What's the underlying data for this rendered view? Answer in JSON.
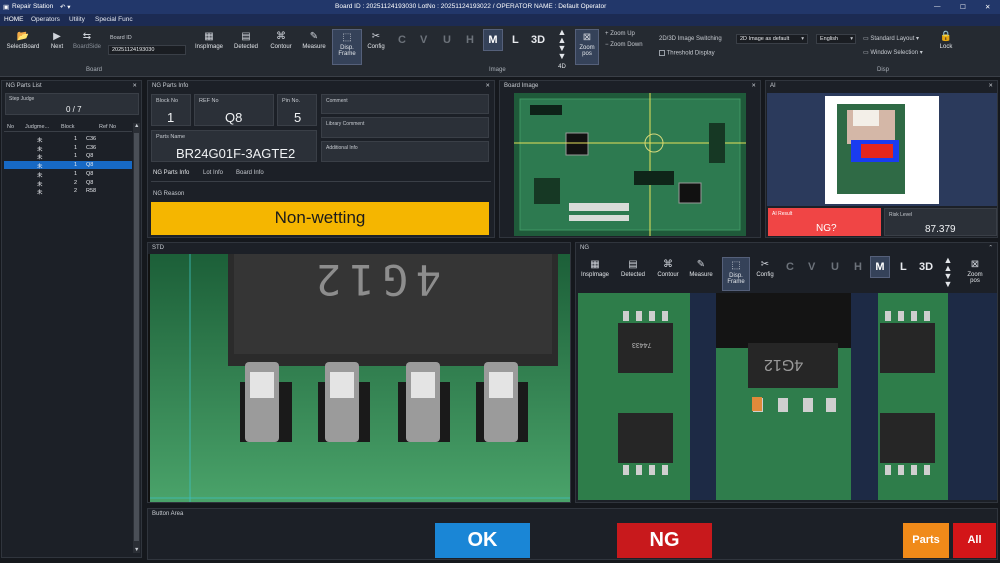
{
  "titlebar": {
    "app": "Repair Station",
    "center": "Board ID : 20251124193030 LotNo : 20251124193022 / OPERATOR NAME : Default Operator"
  },
  "menu": [
    "HOME",
    "Operators",
    "Utility",
    "Special Func"
  ],
  "ribbon": {
    "board_items": [
      "SelectBoard",
      "Next",
      "BoardSide"
    ],
    "board_id_label": "Board ID",
    "board_id_value": "20251124193030",
    "tools": [
      "InspImage",
      "Detected",
      "Contour",
      "Measure",
      "Disp.\nFrame",
      "Config"
    ],
    "letters": [
      "C",
      "V",
      "U",
      "H",
      "M",
      "L",
      "3D"
    ],
    "fourd": "4D",
    "zoom_pos": "Zoom\npos",
    "zoom_up": "Zoom Up",
    "zoom_down": "Zoom Down",
    "switch_label": "2D/3D Image Switching",
    "switch_value": "2D Image as default",
    "threshold": "Threshold Display",
    "language": "English",
    "layout": "Standard Layout",
    "window_selection": "Window Selection",
    "lock": "Lock",
    "groups": [
      "Board",
      "Image",
      "Disp"
    ]
  },
  "ng_list": {
    "title": "NG Parts List",
    "step_label": "Step Judge",
    "step_value": "0 / 7",
    "columns": [
      "No",
      "Judgme...",
      "Block",
      "Ref No"
    ],
    "rows": [
      {
        "judge": "未",
        "block": "1",
        "ref": "C36"
      },
      {
        "judge": "未",
        "block": "1",
        "ref": "C36"
      },
      {
        "judge": "未",
        "block": "1",
        "ref": "Q8"
      },
      {
        "judge": "未",
        "block": "1",
        "ref": "Q8"
      },
      {
        "judge": "未",
        "block": "1",
        "ref": "Q8"
      },
      {
        "judge": "未",
        "block": "2",
        "ref": "Q8"
      },
      {
        "judge": "未",
        "block": "2",
        "ref": "R58"
      }
    ],
    "selected_row": 3
  },
  "ng_info": {
    "title": "NG Parts Info",
    "block_label": "Block No",
    "block_value": "1",
    "ref_label": "REF No",
    "ref_value": "Q8",
    "pin_label": "Pin No.",
    "pin_value": "5",
    "parts_label": "Parts Name",
    "parts_value": "BR24G01F-3AGTE2",
    "comment": "Comment",
    "library_comment": "Library Comment",
    "additional": "Additional Info",
    "tabs": [
      "NG Parts Info",
      "Lot Info",
      "Board Info"
    ],
    "reason_label": "NG Reason",
    "reason_value": "Non-wetting"
  },
  "board_image": {
    "title": "Board Image"
  },
  "ai": {
    "title": "AI",
    "result_label": "AI Result",
    "result_value": "NG?",
    "risk_label": "Risk Level",
    "risk_value": "87.379"
  },
  "std": {
    "title": "STD",
    "chip_text": "4G12"
  },
  "ng_view": {
    "title": "NG",
    "tools": [
      "InspImage",
      "Detected",
      "Contour",
      "Measure",
      "Disp.\nFrame",
      "Config"
    ],
    "letters": [
      "C",
      "V",
      "U",
      "H",
      "M",
      "L",
      "3D"
    ],
    "zoom_pos": "Zoom\npos",
    "chip_codes": [
      "74433",
      "4G12"
    ]
  },
  "button_area": {
    "title": "Button Area",
    "ok": "OK",
    "ng": "NG",
    "parts": "Parts",
    "all": "All"
  },
  "colors": {
    "reason": "#f5b600",
    "ok": "#1a86d6",
    "ng": "#c8191c",
    "parts": "#f08a19",
    "all": "#d31518",
    "ai_result": "#f04545",
    "selected": "#1769c4"
  }
}
